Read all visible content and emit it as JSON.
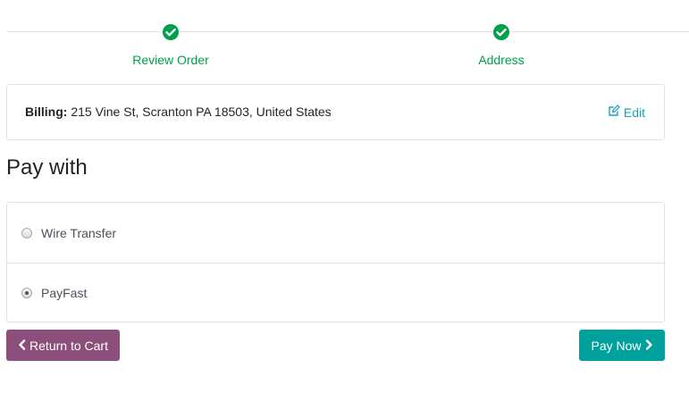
{
  "wizard": {
    "steps": [
      {
        "label": "Review Order",
        "status": "complete"
      },
      {
        "label": "Address",
        "status": "complete"
      }
    ],
    "complete_color": "#00a04a"
  },
  "billing": {
    "label": "Billing:",
    "address": "215 Vine St, Scranton PA 18503, United States",
    "edit_label": "Edit"
  },
  "payment": {
    "heading": "Pay with",
    "methods": [
      {
        "label": "Wire Transfer",
        "selected": false
      },
      {
        "label": "PayFast",
        "selected": true
      }
    ]
  },
  "actions": {
    "return_label": "Return to Cart",
    "pay_label": "Pay Now",
    "return_color": "#8c4f7b",
    "pay_color": "#00a09d"
  }
}
